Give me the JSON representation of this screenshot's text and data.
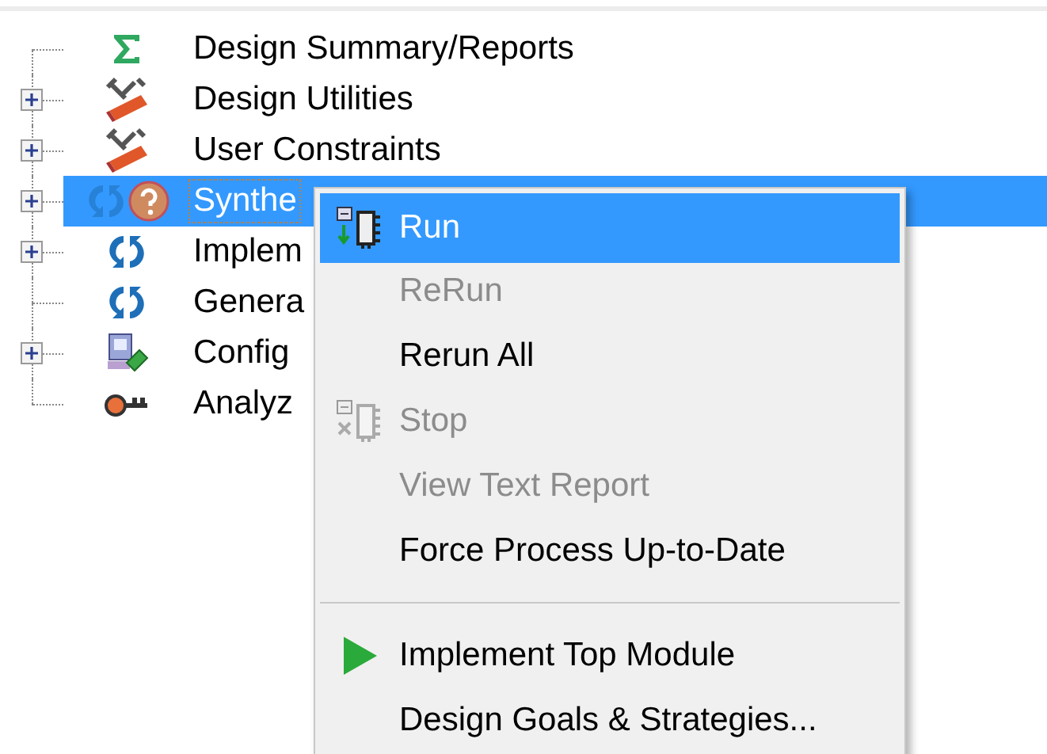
{
  "tree": {
    "items": [
      {
        "label": "Design Summary/Reports",
        "kind": "summary",
        "expandable": false,
        "selected": false,
        "status_unknown": false
      },
      {
        "label": "Design Utilities",
        "kind": "utilities",
        "expandable": true,
        "selected": false,
        "status_unknown": false
      },
      {
        "label": "User Constraints",
        "kind": "utilities",
        "expandable": true,
        "selected": false,
        "status_unknown": false
      },
      {
        "label": "Synthe",
        "kind": "process",
        "expandable": true,
        "selected": true,
        "status_unknown": true
      },
      {
        "label": "Implem",
        "kind": "process",
        "expandable": true,
        "selected": false,
        "status_unknown": false
      },
      {
        "label": "Genera",
        "kind": "process",
        "expandable": false,
        "selected": false,
        "status_unknown": false
      },
      {
        "label": "Config",
        "kind": "config",
        "expandable": true,
        "selected": false,
        "status_unknown": false
      },
      {
        "label": "Analyz",
        "kind": "analyze",
        "expandable": false,
        "selected": false,
        "status_unknown": false
      }
    ]
  },
  "context_menu": {
    "items": [
      {
        "kind": "run",
        "label": "Run",
        "disabled": false,
        "selected": true
      },
      {
        "kind": "item",
        "label": "ReRun",
        "disabled": true,
        "selected": false
      },
      {
        "kind": "item",
        "label": "Rerun All",
        "disabled": false,
        "selected": false
      },
      {
        "kind": "stop",
        "label": "Stop",
        "disabled": true,
        "selected": false
      },
      {
        "kind": "item",
        "label": "View Text Report",
        "disabled": true,
        "selected": false
      },
      {
        "kind": "item",
        "label": "Force Process Up-to-Date",
        "disabled": false,
        "selected": false
      },
      {
        "kind": "separator"
      },
      {
        "kind": "play",
        "label": "Implement Top Module",
        "disabled": false,
        "selected": false
      },
      {
        "kind": "item",
        "label": "Design Goals & Strategies...",
        "disabled": false,
        "selected": false
      }
    ]
  }
}
